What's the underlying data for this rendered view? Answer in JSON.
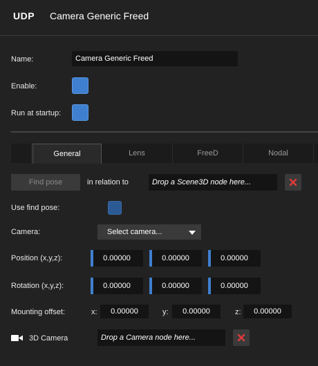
{
  "header": {
    "badge": "UDP",
    "title": "Camera Generic Freed"
  },
  "settings": {
    "name_label": "Name:",
    "name_value": "Camera Generic Freed",
    "enable_label": "Enable:",
    "enable_checked": true,
    "startup_label": "Run at startup:",
    "startup_checked": true
  },
  "tabs": [
    {
      "label": "General",
      "active": true
    },
    {
      "label": "Lens",
      "active": false
    },
    {
      "label": "FreeD",
      "active": false
    },
    {
      "label": "Nodal",
      "active": false
    }
  ],
  "general": {
    "find_pose_button": "Find pose",
    "relation_label": "in relation to",
    "scene_drop_placeholder": "Drop a Scene3D node here...",
    "use_find_pose_label": "Use find pose:",
    "use_find_pose_checked": false,
    "camera_label": "Camera:",
    "camera_select": "Select camera...",
    "position_label": "Position (x,y,z):",
    "position": [
      "0.00000",
      "0.00000",
      "0.00000"
    ],
    "rotation_label": "Rotation (x,y,z):",
    "rotation": [
      "0.00000",
      "0.00000",
      "0.00000"
    ],
    "mounting_label": "Mounting offset:",
    "mounting": {
      "x_label": "x:",
      "x": "0.00000",
      "y_label": "y:",
      "y": "0.00000",
      "z_label": "z:",
      "z": "0.00000"
    },
    "camera3d_label": "3D Camera",
    "camera3d_drop_placeholder": "Drop a Camera node here..."
  },
  "colors": {
    "accent": "#3f7fcf",
    "clear_x": "#e03a3a",
    "background": "#222222"
  }
}
